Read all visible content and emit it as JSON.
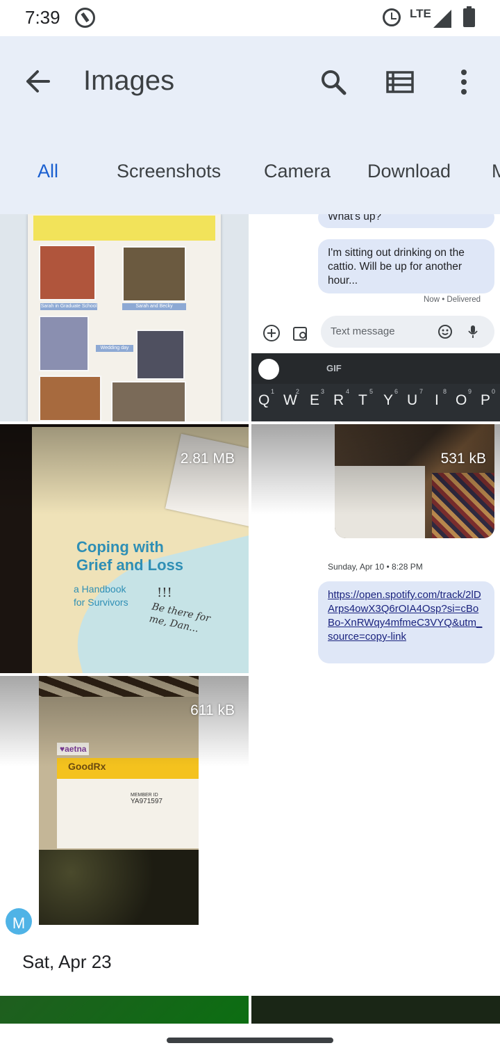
{
  "status_bar": {
    "time": "7:39",
    "network": "LTE"
  },
  "app_bar": {
    "title": "Images",
    "back_icon": "arrow-back-icon",
    "search_icon": "search-icon",
    "view_icon": "list-view-icon",
    "more_icon": "more-vert-icon"
  },
  "tabs": [
    {
      "label": "All",
      "active": true
    },
    {
      "label": "Screenshots",
      "active": false
    },
    {
      "label": "Camera",
      "active": false
    },
    {
      "label": "Download",
      "active": false
    },
    {
      "label": "M",
      "active": false
    }
  ],
  "thumbnails": {
    "scrapbook": {
      "captions": [
        "Sarah in Graduate School",
        "Sarah and Becky",
        "Wedding day"
      ]
    },
    "messages": {
      "partial_bubble": "What's up?",
      "bubble": "I'm sitting out drinking on the cattio. Will be up for another hour...",
      "meta": "Now • Delivered",
      "input_placeholder": "Text message",
      "keyboard_keys": [
        "Q",
        "W",
        "E",
        "R",
        "T",
        "Y",
        "U",
        "I",
        "O",
        "P"
      ],
      "keyboard_numbers": [
        "1",
        "2",
        "3",
        "4",
        "5",
        "6",
        "7",
        "8",
        "9",
        "0"
      ],
      "gif_label": "GIF"
    },
    "book": {
      "size": "2.81 MB",
      "title_line1": "Coping with",
      "title_line2": "Grief and Loss",
      "subtitle_line1": "a Handbook",
      "subtitle_line2": "for Survivors",
      "handwriting_line1": "Be there for",
      "handwriting_line2": "me, Dan...",
      "marks": "!!!"
    },
    "cat_message": {
      "size": "531 kB",
      "date_separator": "Sunday, Apr 10 • 8:28 PM",
      "link": "https://open.spotify.com/track/2lDArps4owX3Q6rOIA4Osp?si=cBoBo-XnRWqy4mfmeC3VYQ&utm_source=copy-link"
    },
    "card": {
      "size": "611 kB",
      "aetna": "♥aetna",
      "goodrx": "GoodRx",
      "member_id_label": "MEMBER ID",
      "member_id": "YA971597"
    },
    "avatar_letter": "M"
  },
  "section_date": "Sat, Apr 23",
  "colors": {
    "accent": "#1a5fd0",
    "app_bar_bg": "#e8eef8"
  }
}
